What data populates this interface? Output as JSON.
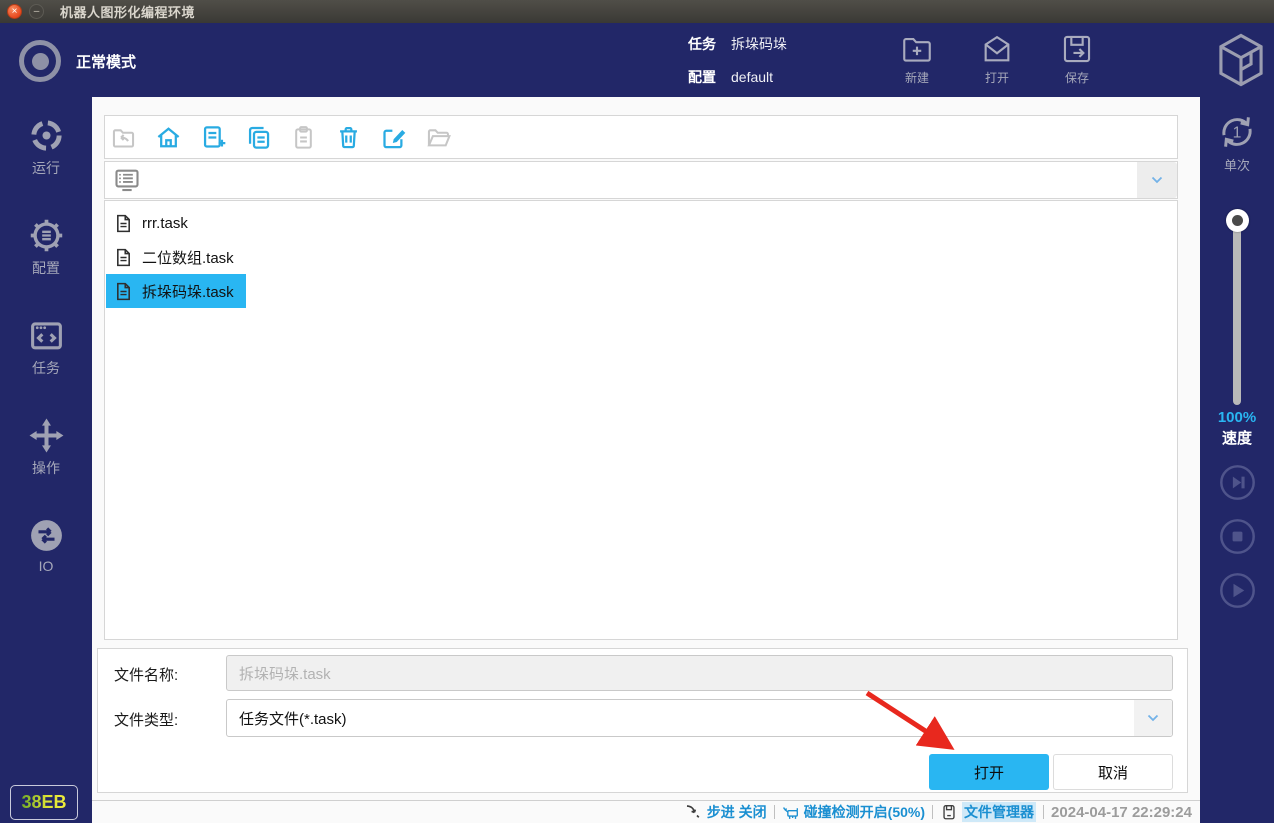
{
  "window": {
    "title": "机器人图形化编程环境"
  },
  "header": {
    "mode": "正常模式",
    "task_label": "任务",
    "task_value": "拆垛码垛",
    "config_label": "配置",
    "config_value": "default",
    "actions": {
      "new": "新建",
      "open": "打开",
      "save": "保存"
    }
  },
  "left_sidebar": {
    "items": [
      {
        "label": "运行"
      },
      {
        "label": "配置"
      },
      {
        "label": "任务"
      },
      {
        "label": "操作"
      },
      {
        "label": "IO"
      }
    ],
    "badge": "38EB"
  },
  "file_browser": {
    "toolbar_icons": [
      "back",
      "home",
      "new-file",
      "copy",
      "paste",
      "delete",
      "edit",
      "open-folder"
    ],
    "files": [
      {
        "name": "rrr.task",
        "selected": false
      },
      {
        "name": "二位数组.task",
        "selected": false
      },
      {
        "name": "拆垛码垛.task",
        "selected": true
      }
    ]
  },
  "dialog_form": {
    "name_label": "文件名称:",
    "name_value": "拆垛码垛.task",
    "type_label": "文件类型:",
    "type_value": "任务文件(*.task)",
    "open_button": "打开",
    "cancel_button": "取消"
  },
  "right_panel": {
    "single_label": "单次",
    "single_icon_number": "1",
    "speed_percent": "100%",
    "speed_label": "速度"
  },
  "status_bar": {
    "step": "步进 关闭",
    "collision": "碰撞检测开启(50%)",
    "file_manager": "文件管理器",
    "datetime": "2024-04-17 22:29:24"
  },
  "colors": {
    "navy": "#222768",
    "accent_cyan": "#29b6f2",
    "toolbar_blue": "#29abe2",
    "status_blue": "#1a8fd1",
    "arrow_red": "#e8281e"
  }
}
